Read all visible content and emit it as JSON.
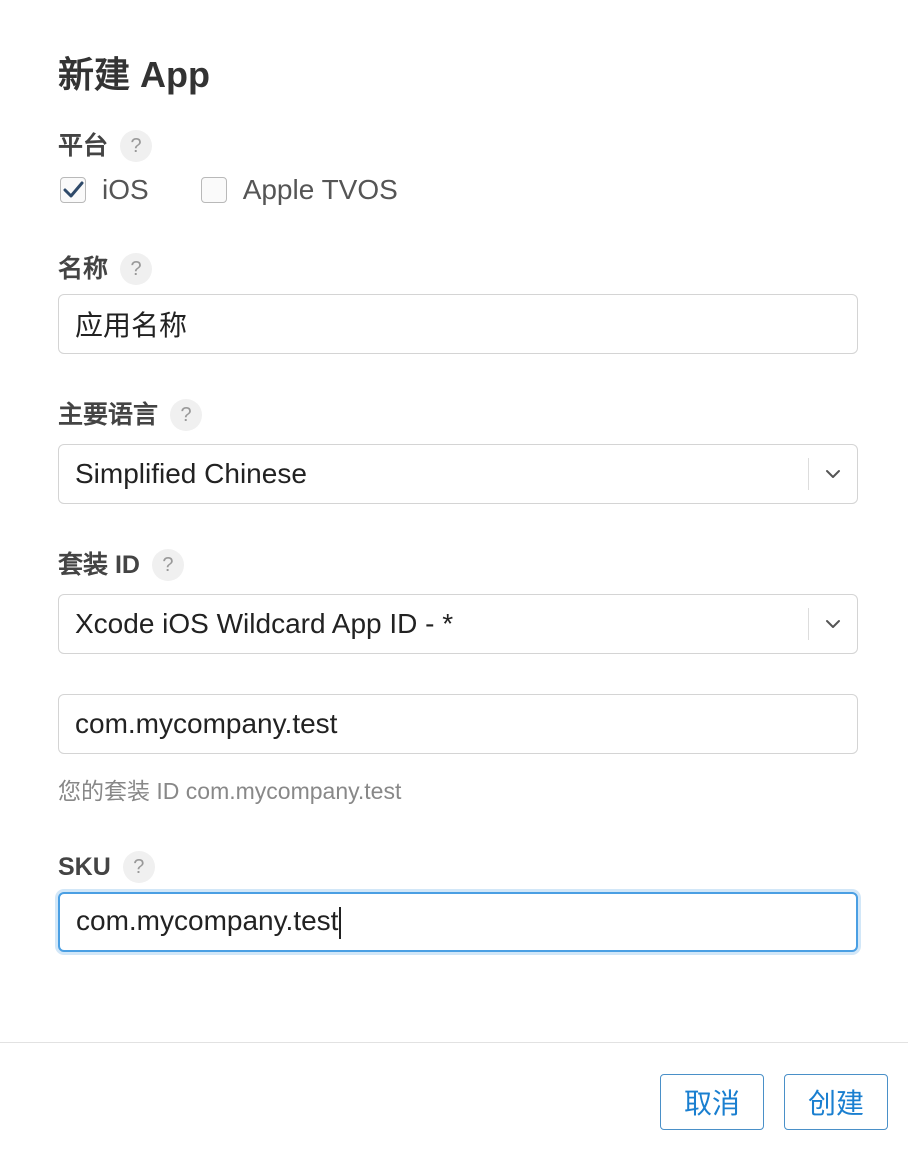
{
  "dialog": {
    "title": "新建 App"
  },
  "help_mark": "?",
  "platform": {
    "label": "平台",
    "options": [
      {
        "label": "iOS",
        "checked": true
      },
      {
        "label": "Apple TVOS",
        "checked": false
      }
    ]
  },
  "name": {
    "label": "名称",
    "value": "应用名称"
  },
  "language": {
    "label": "主要语言",
    "value": "Simplified Chinese"
  },
  "bundle": {
    "label": "套装 ID",
    "value": "Xcode iOS Wildcard App ID - *",
    "suffix_value": "com.mycompany.test",
    "hint": "您的套装 ID com.mycompany.test"
  },
  "sku": {
    "label": "SKU",
    "value": "com.mycompany.test"
  },
  "buttons": {
    "cancel": "取消",
    "create": "创建"
  },
  "colors": {
    "accent": "#1a7fd0",
    "focus_border": "#4a9fe3"
  }
}
